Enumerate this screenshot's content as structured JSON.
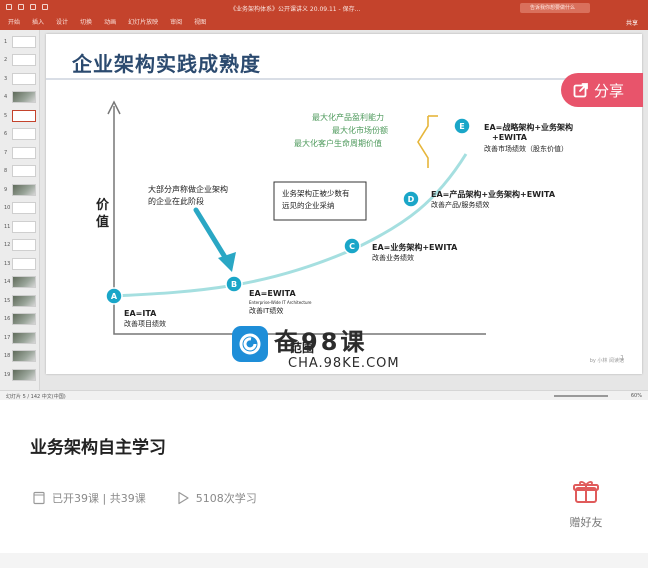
{
  "app": {
    "doc_title": "《业务架构体系》公开课讲义 20.09.11 - 保存…",
    "search_placeholder": "告诉我你想要做什么",
    "share_small": "共享",
    "ribbon_tabs": [
      "开始",
      "插入",
      "设计",
      "切换",
      "动画",
      "幻灯片放映",
      "审阅",
      "视图"
    ]
  },
  "thumbnails": [
    "1",
    "2",
    "3",
    "4",
    "5",
    "6",
    "7",
    "8",
    "9",
    "10",
    "11",
    "12",
    "13",
    "14",
    "15",
    "16",
    "17",
    "18",
    "19"
  ],
  "active_thumbnail": 5,
  "slide": {
    "title": "企业架构实践成熟度",
    "ylabel_1": "价",
    "ylabel_2": "值",
    "xlabel": "范围",
    "page_mark": "1",
    "footer_brand": "by 小林 阅读馆",
    "stages": [
      {
        "letter": "A",
        "head": "EA=ITA",
        "sub": "改善项目绩效",
        "extra": ""
      },
      {
        "letter": "B",
        "head": "EA=EWITA",
        "sub": "改善IT绩效",
        "extra": "Enterprise-Wide IT Architecture"
      },
      {
        "letter": "C",
        "head": "EA=业务架构+EWITA",
        "sub": "改善业务绩效",
        "extra": ""
      },
      {
        "letter": "D",
        "head": "EA=产品架构+业务架构+EWITA",
        "sub": "改善产品/服务绩效",
        "extra": ""
      },
      {
        "letter": "E",
        "head": "EA=战略架构+业务架构",
        "head2": "+EWITA",
        "sub": "改善市场绩效（股东价值）",
        "extra": ""
      }
    ],
    "callout_arrow": [
      "大部分声称做企业架构",
      "的企业在此阶段"
    ],
    "callout_box": [
      "业务架构正被少数有",
      "远见的企业采纳"
    ],
    "green_notes": [
      "最大化产品盈利能力",
      "最大化市场份额",
      "最大化客户生命周期价值"
    ]
  },
  "share_button": "分享",
  "statusbar": {
    "left": "幻灯片 5 / 142    中文(中国)",
    "right": "60%"
  },
  "watermark": {
    "brand": "奋98课",
    "url": "CHA.98KE.COM"
  },
  "course": {
    "title": "业务架构自主学习",
    "lessons": "已开39课 | 共39课",
    "plays": "5108次学习",
    "gift_label": "赠好友"
  },
  "colors": {
    "ribbon": "#c4432c",
    "curve": "#a5dfe0",
    "node": "#1aa6c8",
    "arrow": "#2aa7c4",
    "green": "#4e9a5c",
    "bracket": "#e6b63b",
    "share": "#e8546b",
    "gift": "#e05b5b"
  }
}
